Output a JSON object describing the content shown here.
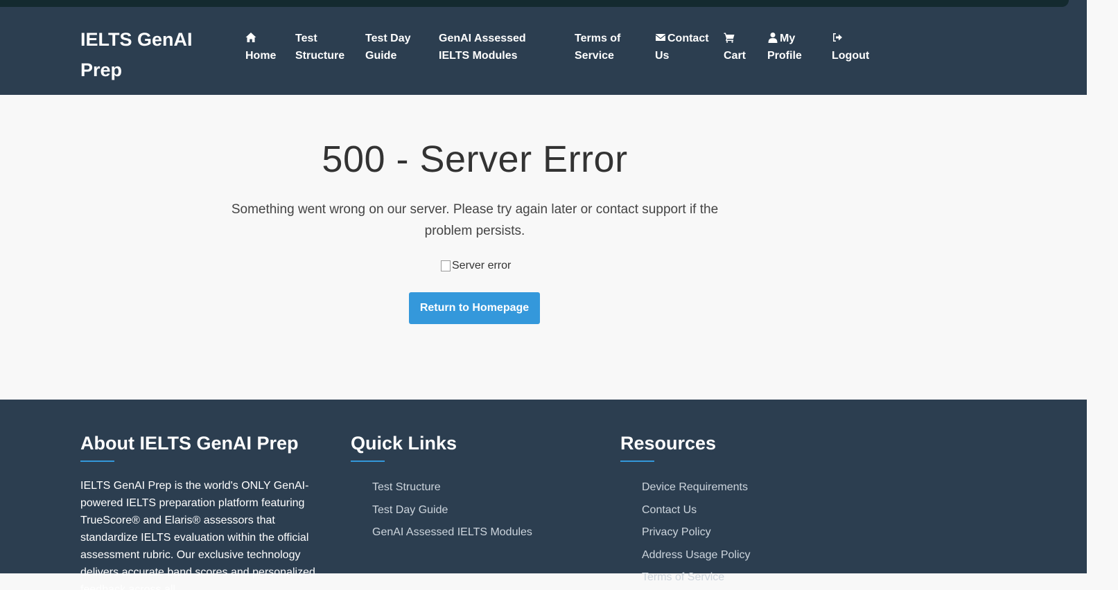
{
  "nav": {
    "brand": "IELTS GenAI Prep",
    "items": [
      {
        "label": "Home",
        "icon": "home-icon"
      },
      {
        "label": "Test Structure"
      },
      {
        "label": "Test Day Guide"
      },
      {
        "label": "GenAI Assessed IELTS Modules"
      },
      {
        "label": "Terms of Service"
      },
      {
        "label": "Contact Us",
        "icon": "envelope-icon"
      },
      {
        "label": "Cart",
        "icon": "cart-icon"
      },
      {
        "label": "My Profile",
        "icon": "user-icon"
      },
      {
        "label": "Logout",
        "icon": "logout-icon"
      }
    ]
  },
  "error": {
    "title": "500 - Server Error",
    "message": "Something went wrong on our server. Please try again later or contact support if the problem persists.",
    "image_alt": "Server error",
    "button_label": "Return to Homepage"
  },
  "footer": {
    "about": {
      "heading": "About IELTS GenAI Prep",
      "text": "IELTS GenAI Prep is the world's ONLY GenAI-powered IELTS preparation platform featuring TrueScore® and Elaris® assessors that standardize IELTS evaluation within the official assessment rubric. Our exclusive technology delivers accurate band scores and personalized feedback across all"
    },
    "quick_links": {
      "heading": "Quick Links",
      "items": [
        "Test Structure",
        "Test Day Guide",
        "GenAI Assessed IELTS Modules"
      ]
    },
    "resources": {
      "heading": "Resources",
      "items": [
        "Device Requirements",
        "Contact Us",
        "Privacy Policy",
        "Address Usage Policy",
        "Terms of Service"
      ]
    }
  },
  "colors": {
    "header_bg": "#2c3e50",
    "accent": "#3498db",
    "page_bg": "#f8f8f8"
  }
}
